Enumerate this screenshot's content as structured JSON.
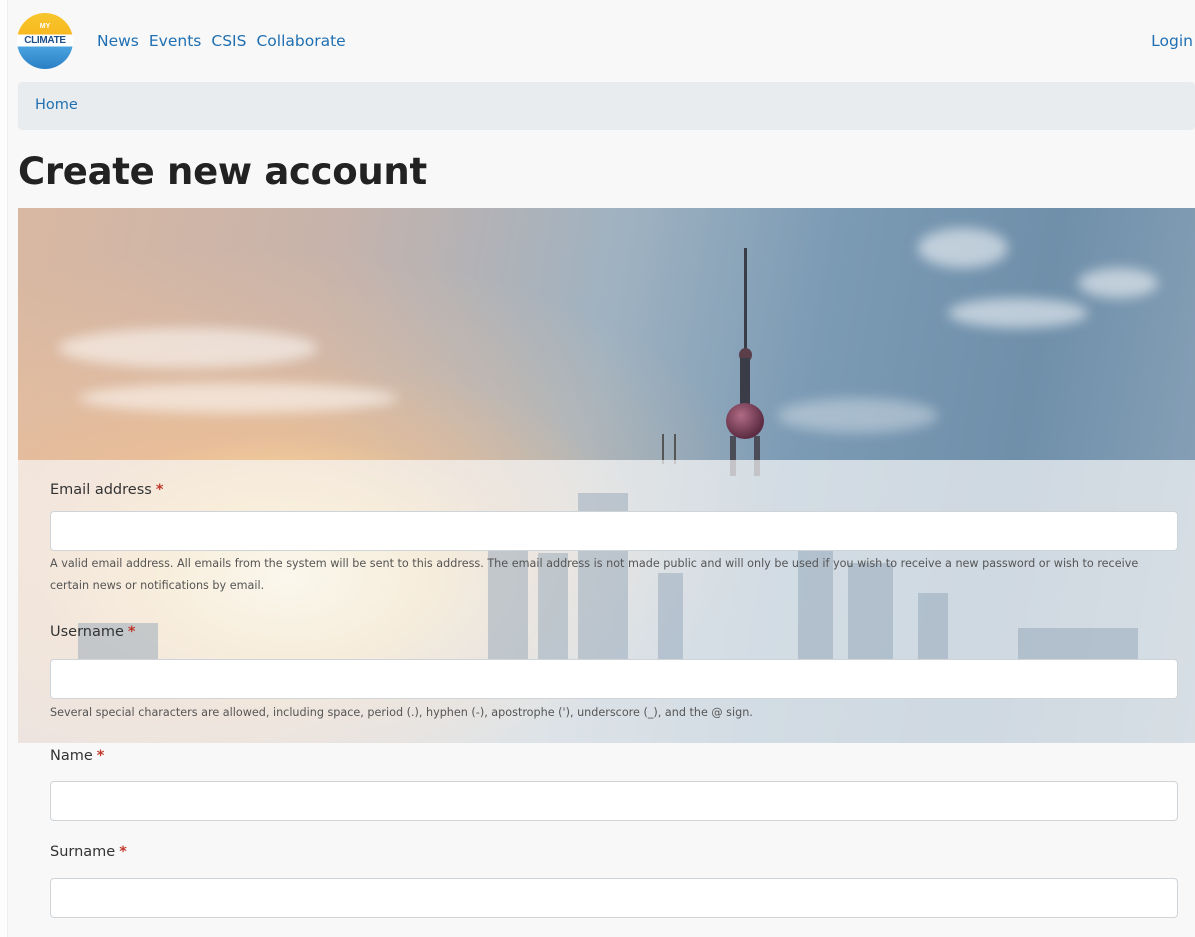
{
  "header": {
    "logo": {
      "top_text": "MY",
      "main_text": "CLIMATE"
    },
    "nav": [
      {
        "label": "News"
      },
      {
        "label": "Events"
      },
      {
        "label": "CSIS"
      },
      {
        "label": "Collaborate"
      }
    ],
    "login_label": "Login"
  },
  "breadcrumb": {
    "home_label": "Home"
  },
  "page": {
    "title": "Create new account"
  },
  "form": {
    "email": {
      "label": "Email address",
      "required_mark": "*",
      "value": "",
      "help": "A valid email address. All emails from the system will be sent to this address. The email address is not made public and will only be used if you wish to receive a new password or wish to receive certain news or notifications by email."
    },
    "username": {
      "label": "Username",
      "required_mark": "*",
      "value": "",
      "help": "Several special characters are allowed, including space, period (.), hyphen (-), apostrophe ('), underscore (_), and the @ sign."
    },
    "name": {
      "label": "Name",
      "required_mark": "*",
      "value": ""
    },
    "surname": {
      "label": "Surname",
      "required_mark": "*",
      "value": ""
    }
  },
  "colors": {
    "link": "#1f6fb2",
    "required": "#c0392b",
    "breadcrumb_bg": "#e9ecee",
    "page_bg": "#f8f8f8"
  }
}
